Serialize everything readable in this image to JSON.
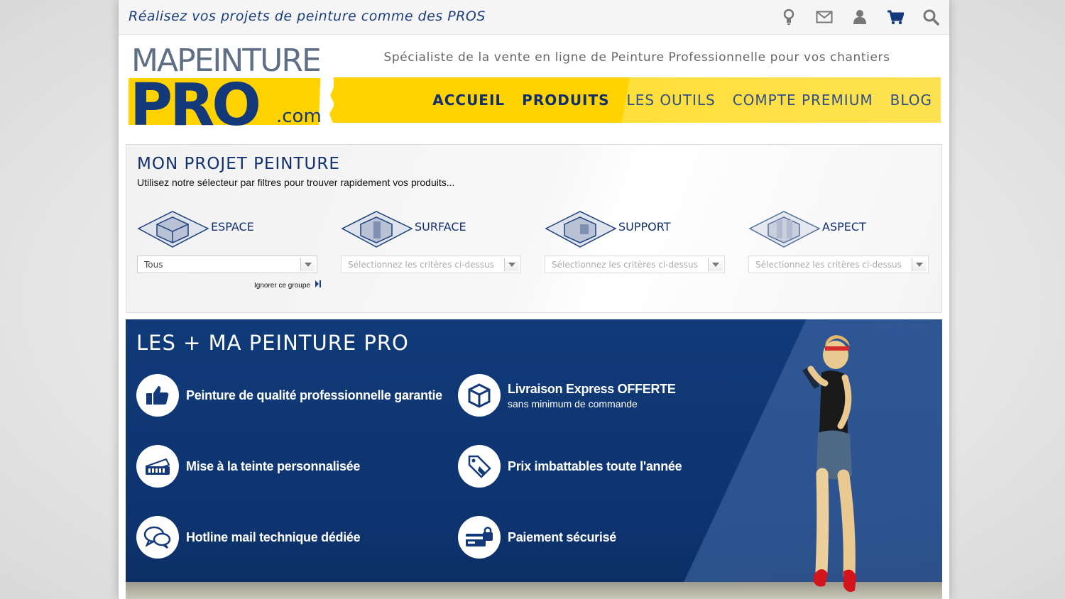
{
  "topbar": {
    "tagline": "Réalisez vos projets de peinture comme des PROS",
    "icons": [
      "lightbulb-icon",
      "envelope-icon",
      "user-icon",
      "cart-icon",
      "search-icon"
    ]
  },
  "header": {
    "logo_line1": "MAPEINTURE",
    "logo_line2": "PRO",
    "logo_suffix": ".com",
    "slogan": "Spécialiste de la vente en ligne de Peinture Professionnelle pour vos chantiers"
  },
  "nav": {
    "items": [
      {
        "label": "ACCUEIL"
      },
      {
        "label": "PRODUITS"
      },
      {
        "label": "LES OUTILS"
      },
      {
        "label": "COMPTE PREMIUM"
      },
      {
        "label": "BLOG"
      }
    ]
  },
  "project": {
    "title": "MON PROJET PEINTURE",
    "subtitle": "Utilisez notre sélecteur par filtres pour trouver rapidement vos produits...",
    "filters": [
      {
        "label": "ESPACE",
        "value": "Tous",
        "enabled": true
      },
      {
        "label": "SURFACE",
        "value": "Sélectionnez les critères ci-dessus",
        "enabled": false
      },
      {
        "label": "SUPPORT",
        "value": "Sélectionnez les critères ci-dessus",
        "enabled": false
      },
      {
        "label": "ASPECT",
        "value": "Sélectionnez les critères ci-dessus",
        "enabled": false
      }
    ],
    "ignore_label": "Ignorer ce groupe"
  },
  "benefits": {
    "title": "LES + MA PEINTURE PRO",
    "items": [
      {
        "title": "Peinture de qualité professionnelle garantie",
        "subtitle": "",
        "icon": "thumbs-up-icon"
      },
      {
        "title": "Livraison Express OFFERTE",
        "subtitle": "sans minimum de commande",
        "icon": "package-icon"
      },
      {
        "title": "Mise à la teinte personnalisée",
        "subtitle": "",
        "icon": "color-fan-icon"
      },
      {
        "title": "Prix imbattables toute l'année",
        "subtitle": "",
        "icon": "price-tag-icon"
      },
      {
        "title": "Hotline mail technique dédiée",
        "subtitle": "",
        "icon": "chat-bubbles-icon"
      },
      {
        "title": "Paiement sécurisé",
        "subtitle": "",
        "icon": "secure-card-icon"
      }
    ]
  },
  "colors": {
    "brand_blue": "#0f2f6e",
    "brand_yellow": "#ffd200",
    "panel_blue": "#103a78"
  }
}
